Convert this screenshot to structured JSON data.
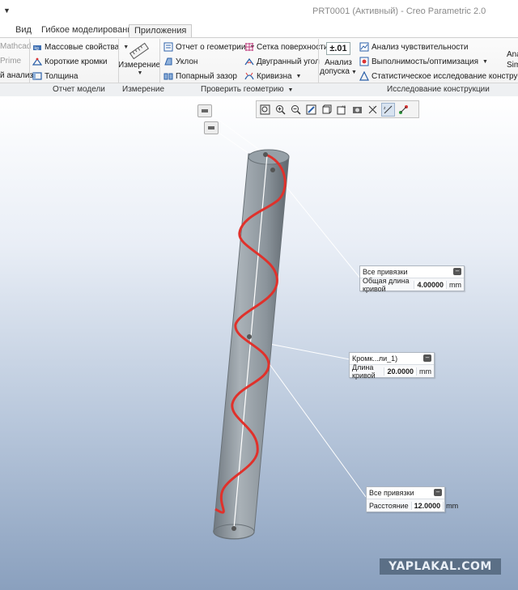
{
  "titlebar": {
    "quick_access": "▼",
    "title": "PRT0001 (Активный) - Creo Parametric 2.0"
  },
  "tabs": [
    "Вид",
    "Гибкое моделирование",
    "Приложения"
  ],
  "ribbon": {
    "col0": [
      "Mathcad",
      "Prime",
      "й анализ"
    ],
    "col1": [
      "Массовые свойства",
      "Короткие кромки",
      "Толщина"
    ],
    "measure": "Измерение",
    "col3": [
      "Отчет о геометрии",
      "Уклон",
      "Попарный зазор"
    ],
    "col4": [
      "Сетка поверхности",
      "Двугранный угол",
      "Кривизна"
    ],
    "tolerance_value": "±.01",
    "tolerance_label_1": "Анализ",
    "tolerance_label_2": "допуска",
    "col6": [
      "Анализ чувствительности",
      "Выполнимость/оптимизация",
      "Статистическое исследование конструкции"
    ],
    "cut_1": "Ana",
    "cut_2": "Sim",
    "groups": {
      "model_report": "Отчет модели",
      "measure": "Измерение",
      "check_geometry": "Проверить геометрию",
      "design_study": "Исследование конструкции"
    }
  },
  "view_toolbar": [
    "zoom-fit",
    "zoom-in",
    "zoom-out",
    "repaint",
    "display-style",
    "saved-views",
    "view-manager",
    "datum-display",
    "annotation-display",
    "spin-center"
  ],
  "tags": [
    {
      "header": "Все привязки",
      "label": "Общая длина кривой",
      "value": "4.00000",
      "unit": "mm"
    },
    {
      "header": "Кромк...ли_1)",
      "label": "Длина кривой",
      "value": "20.0000",
      "unit": "mm"
    },
    {
      "header": "Все привязки",
      "label": "Расстояние",
      "value": "12.0000",
      "unit": "mm"
    }
  ],
  "watermark": "YAPLAKAL.COM",
  "colors": {
    "helix": "#e0312b",
    "cylinder": "#8e979e",
    "accent": "#2a5fa8"
  }
}
